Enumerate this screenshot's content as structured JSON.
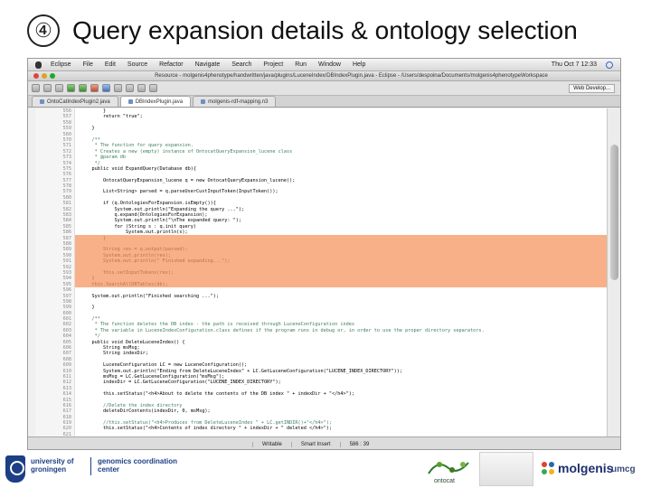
{
  "slide": {
    "number": "④",
    "title": "Query expansion details & ontology selection"
  },
  "menubar": {
    "items": [
      "Eclipse",
      "File",
      "Edit",
      "Source",
      "Refactor",
      "Navigate",
      "Search",
      "Project",
      "Run",
      "Window",
      "Help"
    ],
    "clock": "Thu Oct 7  12:33"
  },
  "window": {
    "title": "Resource - molgenis4phenotype/handwritten/java/plugins/LuceneIndex/DBIndexPlugin.java - Eclipse - /Users/despoina/Documents/molgenis4phenotypeWorkspace"
  },
  "toolbar": {
    "perspective": "Web Develop..."
  },
  "tabs": [
    {
      "label": "OntoCatIndexPlugin2.java",
      "active": false
    },
    {
      "label": "DBIndexPlugin.java",
      "active": true
    },
    {
      "label": "molgenis-rdf-mapping.n3",
      "active": false
    }
  ],
  "code": {
    "line_numbers": [
      "556",
      "557",
      "558",
      "559",
      "560",
      "570",
      "571",
      "572",
      "573",
      "574",
      "575",
      "576",
      "577",
      "578",
      "579",
      "580",
      "581",
      "582",
      "583",
      "584",
      "585",
      "586",
      "587",
      "588",
      "589",
      "590",
      "591",
      "592",
      "593",
      "594",
      "595",
      "596",
      "597",
      "598",
      "599",
      "600",
      "601",
      "602",
      "603",
      "604",
      "605",
      "606",
      "607",
      "608",
      "609",
      "610",
      "611",
      "612",
      "613",
      "614",
      "615",
      "616",
      "617",
      "618",
      "619",
      "620",
      "621"
    ],
    "lines": [
      "        }",
      "        return \"true\";",
      "",
      "    }",
      "",
      "    /**",
      "     * The function for query expansion.",
      "     * Creates a new (empty) instance of OntocatQueryExpansion_lucene class",
      "     * @param db",
      "     */",
      "    public void ExpandQuery(Database db){",
      "",
      "        OntocatQueryExpansion_lucene q = new OntocatQueryExpansion_lucene();",
      "",
      "        List<String> parsed = q.parseUserCustInputToken(InputToken());",
      "",
      "        if (q.OntologiesForExpansion.isEmpty()){",
      "            System.out.println(\"Expanding the query ...\");",
      "            q.expand(OntologiesForExpansion);",
      "            System.out.println(\"\\nThe expanded query: \");",
      "            for (String s : q.init query)",
      "                System.out.println(s);",
      "        }",
      "",
      "        String res = q.output(parsed);",
      "        System.out.println(res);",
      "        System.out.println(\" Finished expanding...\");",
      "",
      "        this.setInputTokens(res);",
      "    }",
      "    this.SearchAllDBTables(db);",
      "",
      "    System.out.println(\"Finished searching ...\");",
      "",
      "    }",
      "",
      "    /**",
      "     * The function deletes the DB index - the path is received through LuceneConfiguration index",
      "     * The variable in LuceneIndexConfiguration.class defines if the program runs in debug or, in order to use the proper directory separators.",
      "     */",
      "    public void DeleteLuceneIndex() {",
      "        String msMsg;",
      "        String indexDir;",
      "",
      "        LuceneConfiguration LC = new LuceneConfiguration();",
      "        System.out.println(\"Ending from DeleteLuceneIndex\" + LC.GetLuceneConfiguration(\"LUCENE_INDEX_DIRECTORY\"));",
      "        msMsg = LC.GetLuceneConfiguration(\"msMsg\");",
      "        indexDir = LC.GetLuceneConfiguration(\"LUCENE_INDEX_DIRECTORY\");",
      "",
      "        this.setStatus(\"<h4>About to delete the contents of the DB index \" + indexDir + \"</h4>\");",
      "",
      "        //Delete the index directory",
      "        deleteDirContents(indexDir, 0, msMsg);",
      "",
      "        //this.setStatus(\"<h4>Produces from DeleteLuceneIndex \" + LC.getINDIR()+\"</h4>\");",
      "        this.setStatus(\"<h4>Contents of index directory \" + indexDir + \" deleted </h4>\");",
      ""
    ]
  },
  "statusbar": {
    "mode": "Writable",
    "insert": "Smart Insert",
    "position": "586 : 39"
  },
  "footer": {
    "university": [
      "university of",
      "groningen"
    ],
    "gcc": [
      "genomics coordination",
      "center"
    ],
    "ontocat": "ontocat",
    "molgenis": "molgenis",
    "umcg": "umcg"
  },
  "colors": {
    "highlight": "#f4a070",
    "brand_blue": "#1c3f85"
  }
}
